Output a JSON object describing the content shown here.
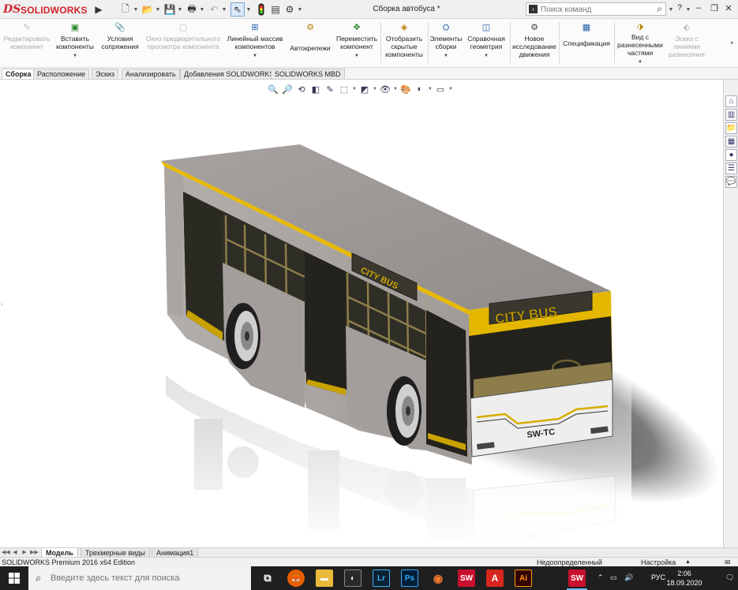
{
  "app": {
    "logo": "SOLIDWORKS",
    "logo_mark": "DS",
    "document_title": "Сборка автобуса *"
  },
  "quick_access": {
    "icons": [
      "new-file-icon",
      "open-icon",
      "save-icon",
      "print-icon",
      "undo-icon",
      "select-icon",
      "rebuild-icon",
      "file-properties-icon",
      "options-icon"
    ]
  },
  "search": {
    "placeholder": "Поиск команд"
  },
  "window_controls": {
    "help": "?",
    "minimize": "–",
    "restore": "❐",
    "close": "✕"
  },
  "ribbon": {
    "buttons": [
      {
        "label": "Редактировать компонент",
        "disabled": true,
        "icon": "edit-component-icon"
      },
      {
        "label": "Вставить компоненты",
        "disabled": false,
        "icon": "insert-components-icon",
        "dropdown": true
      },
      {
        "label": "Условия сопряжения",
        "disabled": false,
        "icon": "mate-icon"
      },
      {
        "label": "Окно предварительного просмотра компонента",
        "disabled": true,
        "icon": "preview-window-icon"
      },
      {
        "label": "Линейный массив компонентов",
        "disabled": false,
        "icon": "linear-pattern-icon",
        "dropdown": true
      },
      {
        "label": "Автокрепежи",
        "disabled": false,
        "icon": "smart-fasteners-icon"
      },
      {
        "label": "Переместить компонент",
        "disabled": false,
        "icon": "move-component-icon",
        "dropdown": true
      },
      {
        "label": "Отобразить скрытые компоненты",
        "disabled": false,
        "icon": "show-hidden-icon"
      },
      {
        "label": "Элементы сборки",
        "disabled": false,
        "icon": "assembly-features-icon",
        "dropdown": true
      },
      {
        "label": "Справочная геометрия",
        "disabled": false,
        "icon": "reference-geometry-icon",
        "dropdown": true
      },
      {
        "label": "Новое исследование движения",
        "disabled": false,
        "icon": "motion-study-icon"
      },
      {
        "label": "Спецификация",
        "disabled": false,
        "icon": "bom-icon"
      },
      {
        "label": "Вид с разнесенными частями",
        "disabled": false,
        "icon": "exploded-view-icon",
        "dropdown": true
      },
      {
        "label": "Эскиз с линиями разнесения",
        "disabled": true,
        "icon": "explode-line-sketch-icon"
      }
    ]
  },
  "command_tabs": [
    {
      "label": "Сборка",
      "active": true
    },
    {
      "label": "Расположение",
      "active": false
    },
    {
      "label": "Эскиз",
      "active": false
    },
    {
      "label": "Анализировать",
      "active": false
    },
    {
      "label": "Добавления SOLIDWORKS",
      "active": false
    },
    {
      "label": "SOLIDWORKS MBD",
      "active": false
    }
  ],
  "model": {
    "sign_front": "CITY BUS",
    "sign_side": "CITY BUS",
    "plate": "SW-TC",
    "colors": {
      "body": "#a8a39f",
      "roof": "#9e9896",
      "stripe": "#f2c500",
      "panel": "#f0f0f0",
      "shadow": "#3a3a3a",
      "dark": "#2a2a26"
    }
  },
  "bottom_tabs": [
    {
      "label": "Модель",
      "active": true
    },
    {
      "label": "Трехмерные виды",
      "active": false
    },
    {
      "label": "Анимация1",
      "active": false
    }
  ],
  "status": {
    "product": "SOLIDWORKS Premium 2016 x64 Edition",
    "state": "Недоопределенный",
    "custom": "Настройка"
  },
  "taskbar": {
    "search_placeholder": "Введите здесь текст для поиска",
    "apps": [
      "task-view-icon",
      "firefox-icon",
      "explorer-icon",
      "excel-viewer-icon",
      "lightroom-icon",
      "photoshop-icon",
      "blender-icon",
      "solidworks-2016-icon",
      "acrobat-icon",
      "illustrator-icon",
      "solidworks-2016-active-icon"
    ],
    "app_labels": {
      "lr": "Lr",
      "ps": "Ps",
      "ai": "Ai",
      "sw": "SW"
    },
    "lang": "РУС",
    "time": "2:06",
    "date": "18.09.2020"
  }
}
